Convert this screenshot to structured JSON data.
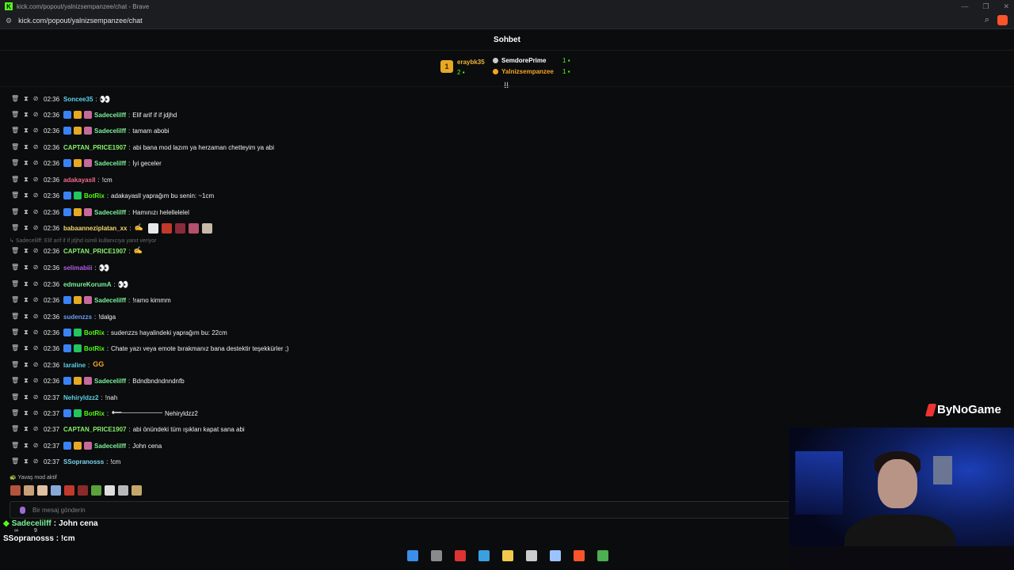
{
  "browser": {
    "tab_title": "kick.com/popout/yalnizsempanzee/chat - Brave",
    "url": "kick.com/popout/yalnizsempanzee/chat",
    "window_controls": [
      "—",
      "❐",
      "✕"
    ]
  },
  "chat": {
    "title": "Sohbet",
    "pinned": {
      "gifter_rank": "1",
      "gifter_name": "eraybk35",
      "gifter_count": "2",
      "supporters": [
        {
          "name": "SemdorePrime",
          "count": "1"
        },
        {
          "name": "Yalnizsempanzee",
          "count": "1"
        }
      ]
    },
    "messages": [
      {
        "time": "02:36",
        "user": "Soncee35",
        "text": "",
        "user_color": "#5dd5f0",
        "badges": [],
        "emotes": [
          "eyes"
        ]
      },
      {
        "time": "02:36",
        "user": "Sadecelilff",
        "text": "Elif arif if if jdjhd",
        "user_color": "#7bf29a",
        "badges": [
          "blue",
          "gold",
          "pink"
        ],
        "emotes": []
      },
      {
        "time": "02:36",
        "user": "Sadecelilff",
        "text": "tamam abobi",
        "user_color": "#7bf29a",
        "badges": [
          "blue",
          "gold",
          "pink"
        ],
        "emotes": []
      },
      {
        "time": "02:36",
        "user": "CAPTAN_PRICE1907",
        "text": "abi bana mod lazım ya herzaman chetteyim ya abi",
        "user_color": "#86f26a",
        "badges": [],
        "emotes": []
      },
      {
        "time": "02:36",
        "user": "Sadecelilff",
        "text": "İyi geceler",
        "user_color": "#7bf29a",
        "badges": [
          "blue",
          "gold",
          "pink"
        ],
        "emotes": []
      },
      {
        "time": "02:36",
        "user": "adakayasll",
        "text": "!cm",
        "user_color": "#f26a8d",
        "badges": [],
        "emotes": []
      },
      {
        "time": "02:36",
        "user": "BotRix",
        "text": "adakayasll yaprağım bu senin: ~1cm",
        "user_color": "#53fc18",
        "badges": [
          "blue",
          "green"
        ],
        "emotes": []
      },
      {
        "time": "02:36",
        "user": "Sadecelilff",
        "text": "Hamınızı helellelelel",
        "user_color": "#7bf29a",
        "badges": [
          "blue",
          "gold",
          "pink"
        ],
        "emotes": []
      },
      {
        "time": "02:36",
        "user": "babaanneziplatan_xx",
        "text": "",
        "user_color": "#f5d76e",
        "badges": [],
        "emotes": [
          "sig",
          "face",
          "ban",
          "red",
          "pinkimg",
          "bear"
        ]
      },
      {
        "time": "02:36",
        "user": "CAPTAN_PRICE1907",
        "text": "",
        "user_color": "#86f26a",
        "badges": [],
        "emotes": [
          "sig"
        ]
      },
      {
        "time": "02:36",
        "user": "selimabiii",
        "text": "",
        "user_color": "#b45cf0",
        "badges": [],
        "emotes": [
          "eyes"
        ]
      },
      {
        "time": "02:36",
        "user": "edmureKorumA",
        "text": "",
        "user_color": "#7bf29a",
        "badges": [],
        "emotes": [
          "eyes"
        ]
      },
      {
        "time": "02:36",
        "user": "Sadecelilff",
        "text": "!ramo kimmm",
        "user_color": "#7bf29a",
        "badges": [
          "blue",
          "gold",
          "pink"
        ],
        "emotes": []
      },
      {
        "time": "02:36",
        "user": "sudenzzs",
        "text": "!dalga",
        "user_color": "#6a9cf2",
        "badges": [],
        "emotes": []
      },
      {
        "time": "02:36",
        "user": "BotRix",
        "text": "sudenzzs hayalindeki yaprağım bu: 22cm",
        "user_color": "#53fc18",
        "badges": [
          "blue",
          "green"
        ],
        "emotes": []
      },
      {
        "time": "02:36",
        "user": "BotRix",
        "text": "Chate yazı veya emote bırakmanız bana destektir teşekkürler ;)",
        "user_color": "#53fc18",
        "badges": [
          "blue",
          "green"
        ],
        "emotes": []
      },
      {
        "time": "02:36",
        "user": "laraline",
        "text": "",
        "user_color": "#5ad1e8",
        "badges": [],
        "emotes": [
          "gg"
        ]
      },
      {
        "time": "02:36",
        "user": "Sadecelilff",
        "text": "Bdndbndndnndnfb",
        "user_color": "#7bf29a",
        "badges": [
          "blue",
          "gold",
          "pink"
        ],
        "emotes": []
      },
      {
        "time": "02:37",
        "user": "Nehiryldzz2",
        "text": "!nah",
        "user_color": "#5ad1e8",
        "badges": [],
        "emotes": []
      },
      {
        "time": "02:37",
        "user": "BotRix",
        "text": "Nehiryldzz2",
        "user_color": "#53fc18",
        "badges": [
          "blue",
          "green"
        ],
        "emotes": [
          "arrow"
        ]
      },
      {
        "time": "02:37",
        "user": "CAPTAN_PRICE1907",
        "text": "abi önündeki tüm ışıkları kapat sana abi",
        "user_color": "#86f26a",
        "badges": [],
        "emotes": []
      },
      {
        "time": "02:37",
        "user": "Sadecelilff",
        "text": "John cena",
        "user_color": "#7bf29a",
        "badges": [
          "blue",
          "gold",
          "pink"
        ],
        "emotes": []
      },
      {
        "time": "02:37",
        "user": "SSopranosss",
        "text": "!cm",
        "user_color": "#7bd3f0",
        "badges": [],
        "emotes": []
      }
    ],
    "reply_notice": "Sadecelilff: Elif arif if if jdjhd isimli kullanıcıya yanıt veriyor",
    "slow_mode": "Yavaş mod aktif",
    "input_placeholder": "Bir mesaj gönderin",
    "emote_bar": [
      "#b5533c",
      "#c9a07a",
      "#e0c0a0",
      "#88a9d8",
      "#c0392b",
      "#8b2a2a",
      "#5aa13a",
      "#dedede",
      "#b8b8b8",
      "#c4a86a"
    ]
  },
  "stream_overlay": {
    "line1_user": "Sadecelilff",
    "line1_text": "John cena",
    "line2_user": "SSopranosss",
    "line2_text": "!cm",
    "stat1": "∞",
    "stat2": "9",
    "brand": "ByNoGame"
  },
  "colors": {
    "accent": "#53fc18",
    "gifter_gold": "#e7a923",
    "supporter_orange": "#f5a623"
  },
  "taskbar": [
    "windows-icon",
    "task-view-icon",
    "snip-icon",
    "store-icon",
    "explorer-icon",
    "obs-icon",
    "steam-icon",
    "brave-icon",
    "chrome-icon"
  ]
}
